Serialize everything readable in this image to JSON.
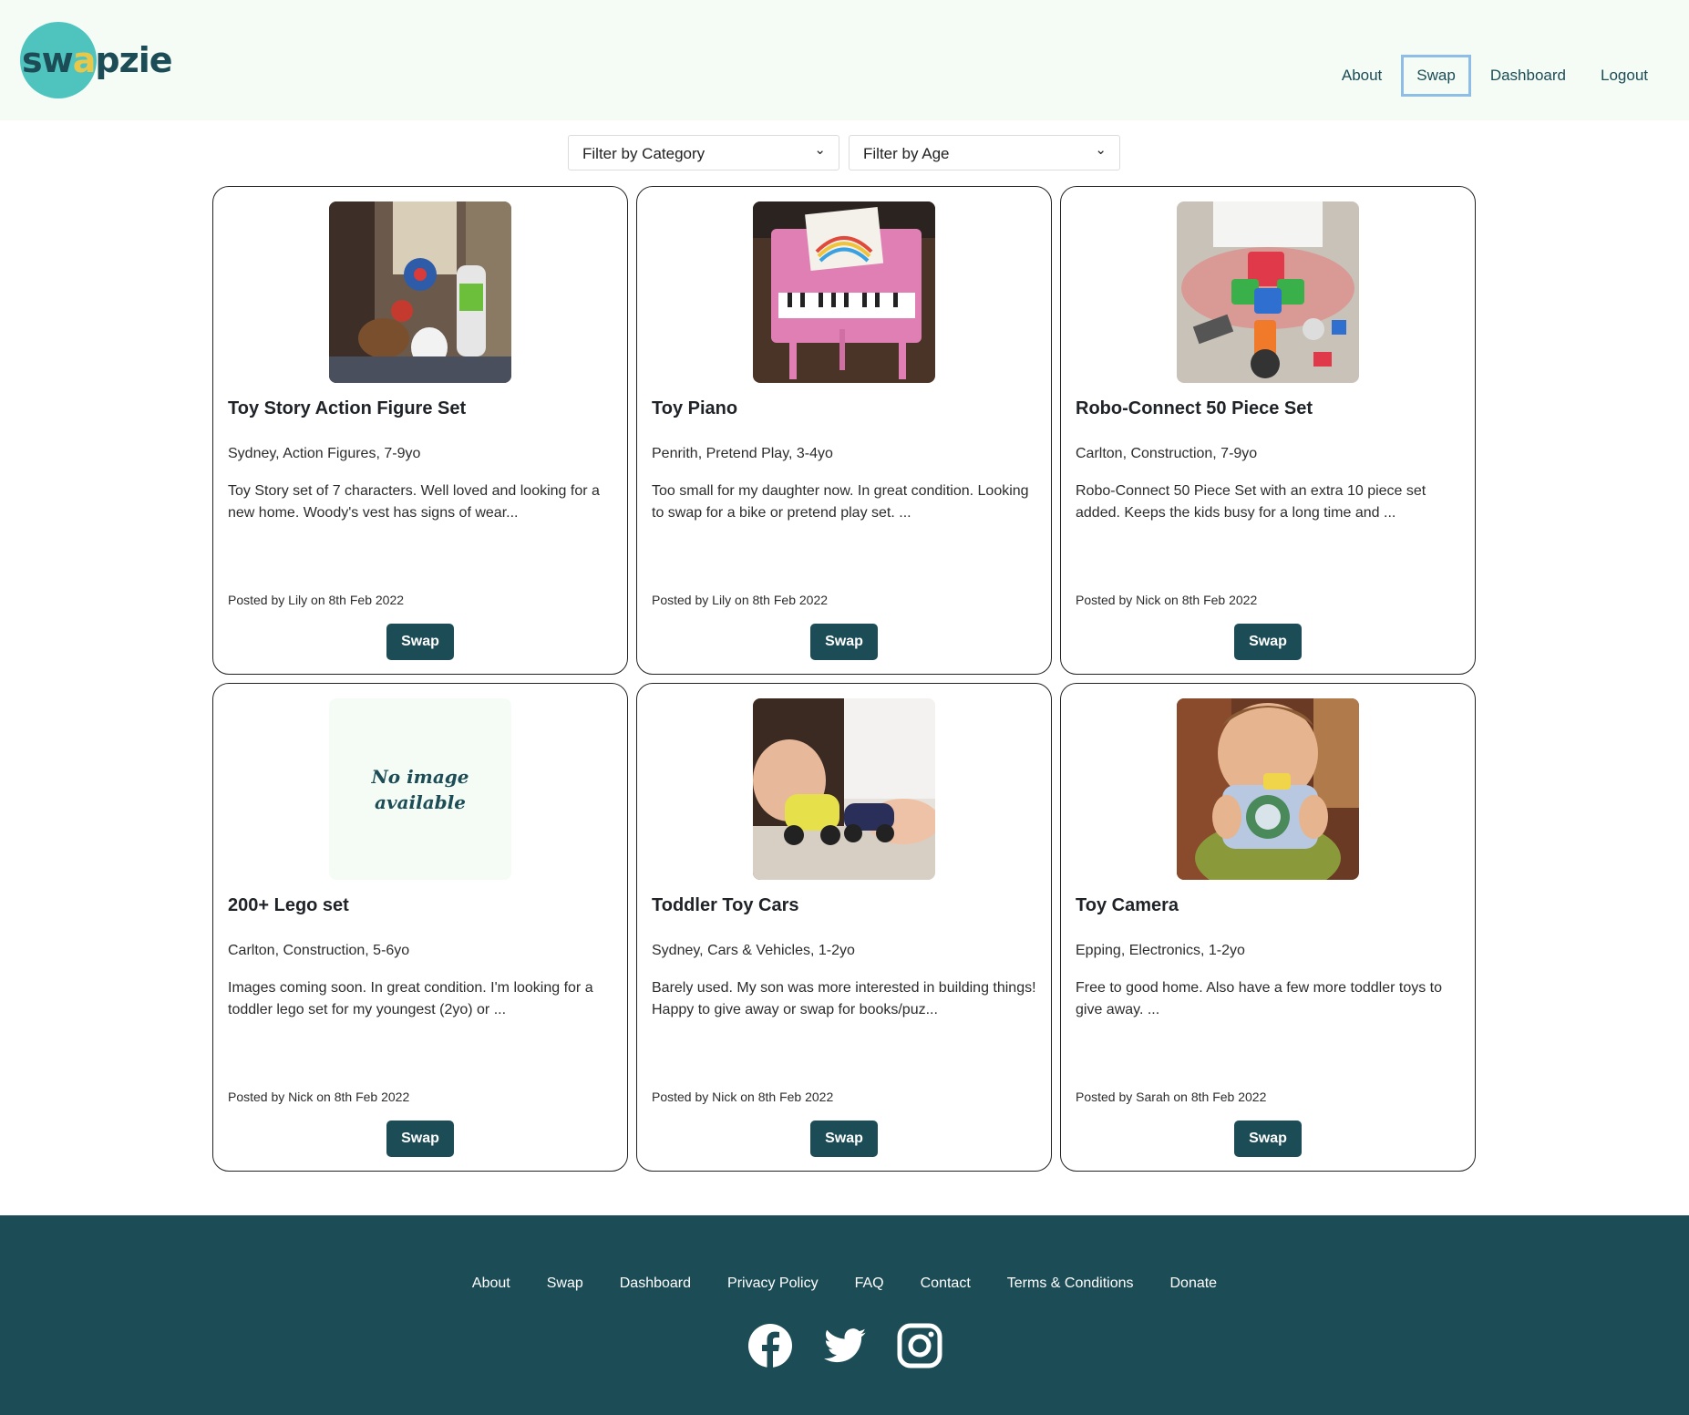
{
  "header": {
    "logo_text_a": "sw",
    "logo_text_b": "a",
    "logo_text_c": "pzie",
    "nav": [
      {
        "label": "About"
      },
      {
        "label": "Swap"
      },
      {
        "label": "Dashboard"
      },
      {
        "label": "Logout"
      }
    ]
  },
  "filters": {
    "category": "Filter by Category",
    "age": "Filter by Age"
  },
  "listings": [
    {
      "title": "Toy Story Action Figure Set",
      "meta": "Sydney, Action Figures, 7-9yo",
      "desc": "Toy Story set of 7 characters. Well loved and looking for a new home. Woody's vest has signs of wear...",
      "posted": "Posted by Lily on 8th Feb 2022",
      "button": "Swap"
    },
    {
      "title": "Toy Piano",
      "meta": "Penrith, Pretend Play, 3-4yo",
      "desc": "Too small for my daughter now. In great condition. Looking to swap for a bike or pretend play set. ...",
      "posted": "Posted by Lily on 8th Feb 2022",
      "button": "Swap"
    },
    {
      "title": "Robo-Connect 50 Piece Set",
      "meta": "Carlton, Construction, 7-9yo",
      "desc": "Robo-Connect 50 Piece Set with an extra 10 piece set added. Keeps the kids busy for a long time and ...",
      "posted": "Posted by Nick on 8th Feb 2022",
      "button": "Swap"
    },
    {
      "title": "200+ Lego set",
      "meta": "Carlton, Construction, 5-6yo",
      "desc": "Images coming soon. In great condition. I'm looking for a toddler lego set for my youngest (2yo) or ...",
      "posted": "Posted by Nick on 8th Feb 2022",
      "button": "Swap",
      "no_image_line1": "No image",
      "no_image_line2": "available"
    },
    {
      "title": "Toddler Toy Cars",
      "meta": "Sydney, Cars & Vehicles, 1-2yo",
      "desc": "Barely used. My son was more interested in building things! Happy to give away or swap for books/puz...",
      "posted": "Posted by Nick on 8th Feb 2022",
      "button": "Swap"
    },
    {
      "title": "Toy Camera",
      "meta": "Epping, Electronics, 1-2yo",
      "desc": "Free to good home. Also have a few more toddler toys to give away. ...",
      "posted": "Posted by Sarah on 8th Feb 2022",
      "button": "Swap"
    }
  ],
  "footer": {
    "links": [
      {
        "label": "About"
      },
      {
        "label": "Swap"
      },
      {
        "label": "Dashboard"
      },
      {
        "label": "Privacy Policy"
      },
      {
        "label": "FAQ"
      },
      {
        "label": "Contact"
      },
      {
        "label": "Terms & Conditions"
      },
      {
        "label": "Donate"
      }
    ],
    "social_icons": [
      "facebook-icon",
      "twitter-icon",
      "instagram-icon"
    ]
  },
  "colors": {
    "brand_dark": "#1c4c56",
    "brand_teal": "#4fc4bf",
    "header_bg": "#f4fcf5",
    "active_nav_border": "#8ebde6"
  }
}
